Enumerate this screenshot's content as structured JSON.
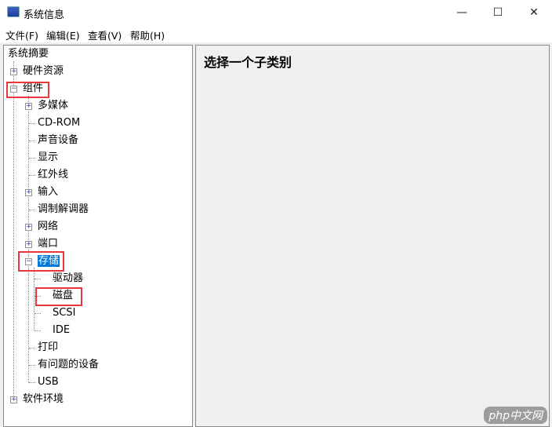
{
  "window": {
    "title": "系统信息",
    "minimize": "—",
    "maximize": "☐",
    "close": "✕"
  },
  "menu": [
    "文件(F)",
    "编辑(E)",
    "查看(V)",
    "帮助(H)"
  ],
  "tree": {
    "root": "系统摘要",
    "hardware": "硬件资源",
    "components": "组件",
    "multimedia": "多媒体",
    "cdrom": "CD-ROM",
    "sound": "声音设备",
    "display": "显示",
    "infrared": "红外线",
    "input": "输入",
    "modem": "调制解调器",
    "network": "网络",
    "ports": "端口",
    "storage": "存储",
    "drives": "驱动器",
    "disks": "磁盘",
    "scsi": "SCSI",
    "ide": "IDE",
    "printing": "打印",
    "problem_devices": "有问题的设备",
    "usb": "USB",
    "software": "软件环境"
  },
  "right": {
    "heading": "选择一个子类别"
  },
  "watermark": "php中文网"
}
